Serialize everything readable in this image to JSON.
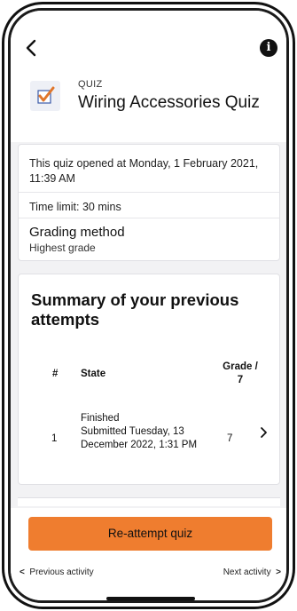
{
  "header": {
    "back_icon": "chevron-left-icon",
    "info_icon": "info-icon",
    "info_glyph": "i",
    "eyebrow": "QUIZ",
    "title": "Wiring Accessories Quiz"
  },
  "info": {
    "opened": "This quiz opened at Monday, 1 February 2021, 11:39 AM",
    "time_limit": "Time limit: 30 mins",
    "grading_label": "Grading method",
    "grading_value": "Highest grade"
  },
  "summary": {
    "title": "Summary of your previous attempts",
    "columns": {
      "number": "#",
      "state": "State",
      "grade": "Grade / 7"
    },
    "attempts": [
      {
        "number": "1",
        "state": "Finished",
        "submitted": "Submitted Tuesday, 13 December 2022, 1:31 PM",
        "grade": "7"
      }
    ]
  },
  "actions": {
    "reattempt_label": "Re-attempt quiz",
    "previous_label": "Previous activity",
    "next_label": "Next activity",
    "previous_chevron": "<",
    "next_chevron": ">"
  },
  "colors": {
    "accent": "#ef7d2f",
    "background": "#f2f2f4",
    "checkbox_check": "#e0762b",
    "checkbox_box": "#3b5aa8"
  }
}
